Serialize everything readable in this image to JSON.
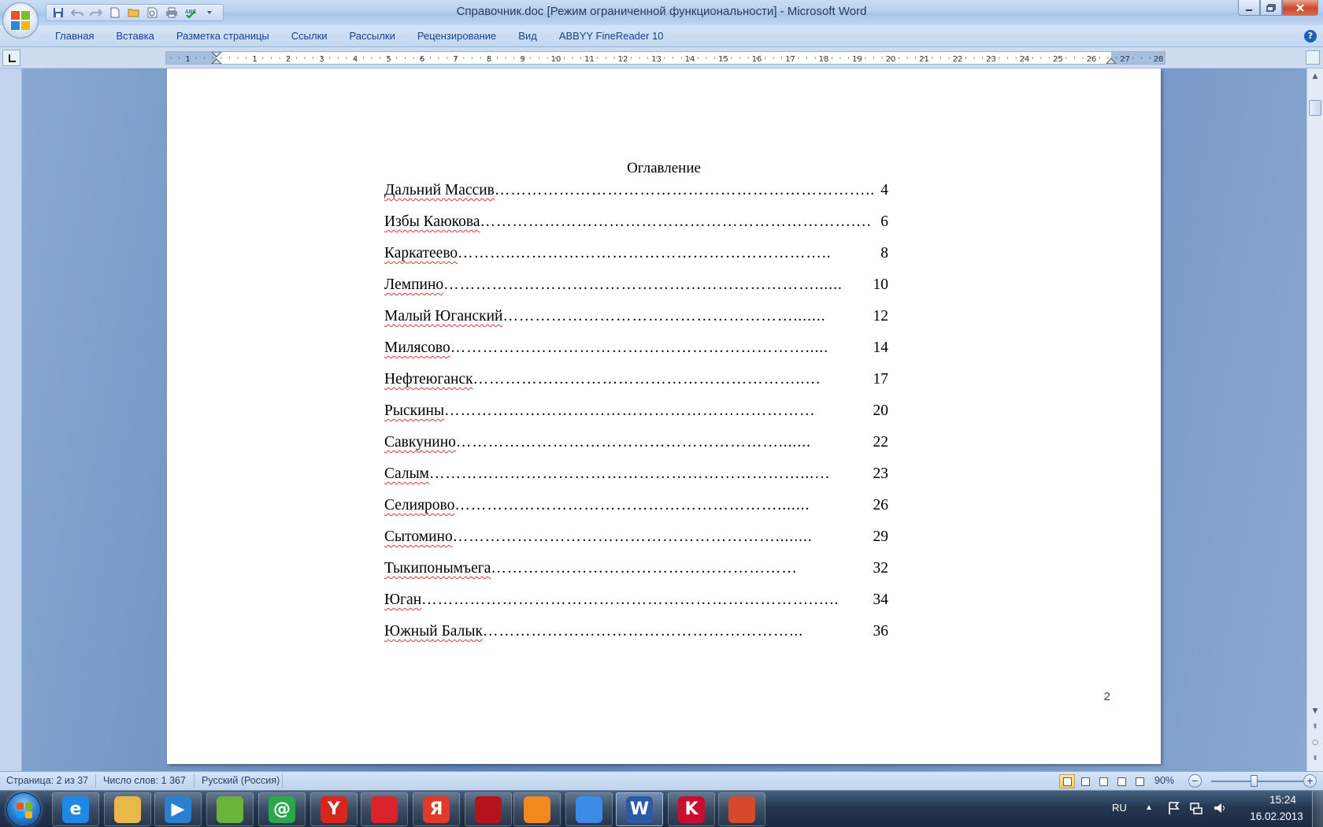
{
  "window": {
    "title": "Справочник.doc [Режим ограниченной функциональности] - Microsoft Word"
  },
  "quick_access": [
    "save-icon",
    "undo-icon",
    "redo-icon",
    "new-document-icon",
    "open-folder-icon",
    "print-preview-icon",
    "print-icon",
    "spelling-check-icon",
    "customize-dropdown-icon"
  ],
  "ribbon_tabs": [
    "Главная",
    "Вставка",
    "Разметка страницы",
    "Ссылки",
    "Рассылки",
    "Рецензирование",
    "Вид",
    "ABBYY FineReader 10"
  ],
  "ruler": {
    "labels": [
      "1",
      "1",
      "2",
      "3",
      "4",
      "5",
      "6",
      "7",
      "8",
      "9",
      "10",
      "11",
      "12",
      "13",
      "14",
      "15",
      "16",
      "17",
      "18",
      "19",
      "20",
      "21",
      "22",
      "23",
      "24",
      "25",
      "26",
      "27",
      "28"
    ]
  },
  "document": {
    "toc_title": "Оглавление",
    "entries": [
      {
        "name": "Дальний Массив",
        "dots": "……………………………………………………………..",
        "page": "4"
      },
      {
        "name": "Избы Каюкова",
        "dots": "…………………………………………………………….…",
        "page": "6"
      },
      {
        "name": "Каркатеево",
        "dots": "………..…………………………………………………..",
        "page": "8"
      },
      {
        "name": "Лемпино",
        "dots": "……………………………………………………………......",
        "page": "10"
      },
      {
        "name": "Малый Юганский",
        "dots": "……………………………………………….......",
        "page": "12"
      },
      {
        "name": "Милясово",
        "dots": "………………………………………………………….....",
        "page": "14"
      },
      {
        "name": "Нефтеюганск ",
        "dots": "……………………………………………………..…",
        "page": "17"
      },
      {
        "name": "Рыскины",
        "dots": "……………………………………………………………",
        "page": "20"
      },
      {
        "name": "Савкунино",
        "dots": "…………………………………………………….......",
        "page": "22"
      },
      {
        "name": "Салым",
        "dots": "……………………………………………………………...…",
        "page": "23"
      },
      {
        "name": "Селиярово",
        "dots": "…………………………………………………….......",
        "page": "26"
      },
      {
        "name": "Сытомино",
        "dots": "……………………………………………………........",
        "page": "29"
      },
      {
        "name": "Тыкипонымъега",
        "dots": "…………………………………………………",
        "page": "32"
      },
      {
        "name": "Юган",
        "dots": "……………………………………………………………….…..",
        "page": "34"
      },
      {
        "name": "Южный Балык",
        "dots": "…………………………………………………...",
        "page": "36"
      }
    ],
    "page_number": "2"
  },
  "status_bar": {
    "page": "Страница: 2 из 37",
    "words": "Число слов: 1 367",
    "language": "Русский (Россия)",
    "zoom": "90%",
    "zoom_value_percent": 90
  },
  "taskbar": {
    "apps": [
      {
        "icon": "internet-explorer-icon",
        "label": "e",
        "color": "#1e88e5"
      },
      {
        "icon": "file-explorer-icon",
        "label": "",
        "color": "#e8b84a"
      },
      {
        "icon": "media-player-icon",
        "label": "▶",
        "color": "#2a7fd0"
      },
      {
        "icon": "green-circle-app-icon",
        "label": "",
        "color": "#6bb33a"
      },
      {
        "icon": "mail-agent-icon",
        "label": "@",
        "color": "#2aa84a"
      },
      {
        "icon": "yandex-browser-icon",
        "label": "Y",
        "color": "#d9261c"
      },
      {
        "icon": "red-app-icon",
        "label": "",
        "color": "#d8232a"
      },
      {
        "icon": "yandex-icon",
        "label": "Я",
        "color": "#e03b2a"
      },
      {
        "icon": "adobe-reader-icon",
        "label": "",
        "color": "#b3141c"
      },
      {
        "icon": "vlc-icon",
        "label": "",
        "color": "#f08a1c"
      },
      {
        "icon": "chrome-icon",
        "label": "",
        "color": "#3b8ae6"
      },
      {
        "icon": "word-icon",
        "label": "W",
        "color": "#2b5aa8"
      },
      {
        "icon": "kaspersky-icon",
        "label": "K",
        "color": "#c8102e"
      },
      {
        "icon": "presentation-app-icon",
        "label": "",
        "color": "#d6492a"
      }
    ],
    "language": "RU",
    "time": "15:24",
    "date": "16.02.2013"
  }
}
